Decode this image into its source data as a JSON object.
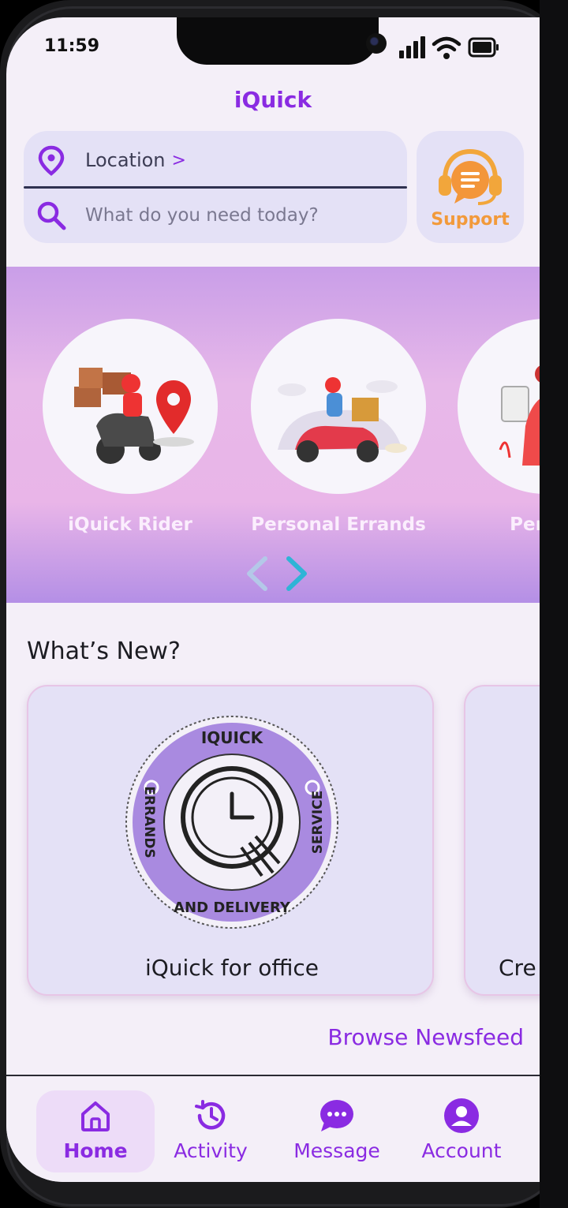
{
  "status_bar": {
    "time": "11:59",
    "icons": [
      "signal-icon",
      "wifi-icon",
      "battery-icon"
    ]
  },
  "header": {
    "title": "iQuick"
  },
  "location": {
    "label": "Location",
    "chevron": ">"
  },
  "search": {
    "placeholder": "What do you need today?"
  },
  "support": {
    "label": "Support"
  },
  "services": [
    {
      "label": "iQuick Rider"
    },
    {
      "label": "Personal Errands"
    },
    {
      "label": "Person"
    }
  ],
  "whats_new": {
    "title": "What’s New?",
    "cards": [
      {
        "label": "iQuick for office",
        "badge_top": "IQUICK",
        "badge_left": "ERRANDS",
        "badge_bottom": "AND DELIVERY",
        "badge_right": "SERVICE"
      },
      {
        "label": "Cre"
      }
    ],
    "browse_label": "Browse Newsfeed"
  },
  "bottom_nav": [
    {
      "label": "Home",
      "icon": "home-icon",
      "active": true
    },
    {
      "label": "Activity",
      "icon": "history-icon",
      "active": false
    },
    {
      "label": "Message",
      "icon": "chat-icon",
      "active": false
    },
    {
      "label": "Account",
      "icon": "account-icon",
      "active": false
    }
  ],
  "colors": {
    "accent": "#8a2be2",
    "support": "#f29a3b",
    "card": "#e4e1f6",
    "background": "#f4eff8"
  }
}
